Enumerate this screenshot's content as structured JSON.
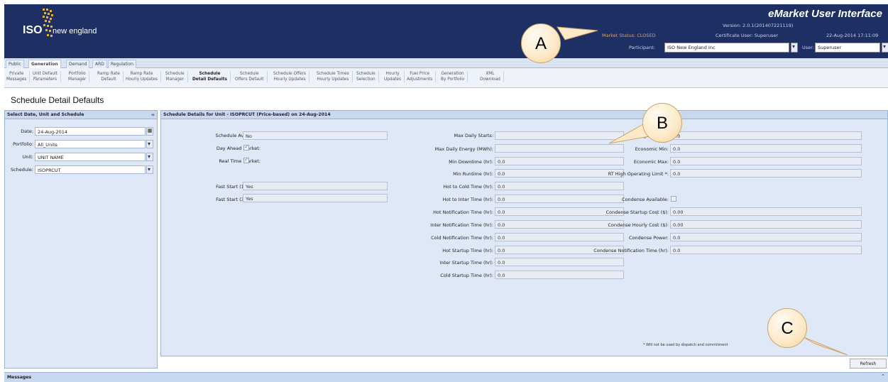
{
  "header": {
    "logo_iso": "ISO",
    "logo_ne": "new england",
    "title": "eMarket User Interface",
    "version": "Version: 2.0.1(201407221119)",
    "market_status": "Market Status: CLOSED",
    "certificate_user": "Certificate User: Superuser",
    "datetime": "22-Aug-2014 17:11:09",
    "participant_label": "Participant:",
    "participant_value": "ISO New England Inc",
    "user_label": "User:",
    "user_value": "Superuser"
  },
  "tabs": [
    "Public",
    "Generation",
    "Demand",
    "ARD",
    "Regulation"
  ],
  "subtabs": [
    [
      "Private",
      "Messages"
    ],
    [
      "Unit Default",
      "Parameters"
    ],
    [
      "Portfolio",
      "Manager"
    ],
    [
      "Ramp Rate",
      "Default"
    ],
    [
      "Ramp Rate",
      "Hourly Updates"
    ],
    [
      "Schedule",
      "Manager"
    ],
    [
      "Schedule",
      "Detail Defaults"
    ],
    [
      "Schedule",
      "Offers Default"
    ],
    [
      "Schedule Offers",
      "Hourly Updates"
    ],
    [
      "Schedule Times",
      "Hourly Updates"
    ],
    [
      "Schedule",
      "Selection"
    ],
    [
      "Hourly",
      "Updates"
    ],
    [
      "Fuel Price",
      "Adjustments"
    ],
    [
      "Generation",
      "By Portfolio"
    ],
    [
      "XML",
      "Download"
    ]
  ],
  "page_title": "Schedule Detail Defaults",
  "left_panel": {
    "title": "Select Date, Unit and Schedule",
    "date_label": "Date:",
    "date_value": "24-Aug-2014",
    "portfolio_label": "Portfolio:",
    "portfolio_value": "All_Units",
    "unit_label": "Unit:",
    "unit_value": "UNIT NAME",
    "schedule_label": "Schedule:",
    "schedule_value": "ISOPRCUT"
  },
  "right_panel": {
    "title": "Schedule Details for Unit - ISOPRCUT (Price-based) on 24-Aug-2014",
    "col1": [
      {
        "label": "Schedule Available:",
        "value": "No"
      },
      {
        "label": "Day Ahead Market:",
        "value": ""
      },
      {
        "label": "Real Time Market:",
        "value": ""
      },
      {
        "label": "Fast Start (10 min):",
        "value": "Yes"
      },
      {
        "label": "Fast Start (30 min):",
        "value": "Yes"
      }
    ],
    "col2": [
      {
        "label": "Max Daily Starts:",
        "value": ""
      },
      {
        "label": "Max Daily Energy (MWh):",
        "value": ""
      },
      {
        "label": "Min Downtime (hr):",
        "value": "0.0"
      },
      {
        "label": "Min Runtime (hr):",
        "value": "0.0"
      },
      {
        "label": "Hot to Cold Time (hr):",
        "value": "0.0"
      },
      {
        "label": "Hot to Inter Time (hr):",
        "value": "0.0"
      },
      {
        "label": "Hot Notification Time (hr):",
        "value": "0.0"
      },
      {
        "label": "Inter Notification Time (hr):",
        "value": "0.0"
      },
      {
        "label": "Cold Notification Time (hr):",
        "value": "0.0"
      },
      {
        "label": "Hot Startup Time (hr):",
        "value": "0.0"
      },
      {
        "label": "Inter Startup Time (hr):",
        "value": "0.0"
      },
      {
        "label": "Cold Startup Time (hr):",
        "value": "0.0"
      }
    ],
    "col3": [
      {
        "label": "Emergency Min:",
        "value": "0.0"
      },
      {
        "label": "Economic Min:",
        "value": "0.0"
      },
      {
        "label": "Economic Max:",
        "value": "0.0"
      },
      {
        "label": "RT High Operating Limit *:",
        "value": "0.0"
      },
      {
        "label": "Condense Available:",
        "value": ""
      },
      {
        "label": "Condense Startup Cost ($):",
        "value": "0.00"
      },
      {
        "label": "Condense Hourly Cost ($):",
        "value": "0.00"
      },
      {
        "label": "Condense Power:",
        "value": "0.0"
      },
      {
        "label": "Condense Notification Time (hr):",
        "value": "0.0"
      }
    ],
    "footnote": "* Will not be used by dispatch and commitment"
  },
  "refresh_label": "Refresh",
  "messages_label": "Messages",
  "callouts": {
    "a": "A",
    "b": "B",
    "c": "C"
  }
}
